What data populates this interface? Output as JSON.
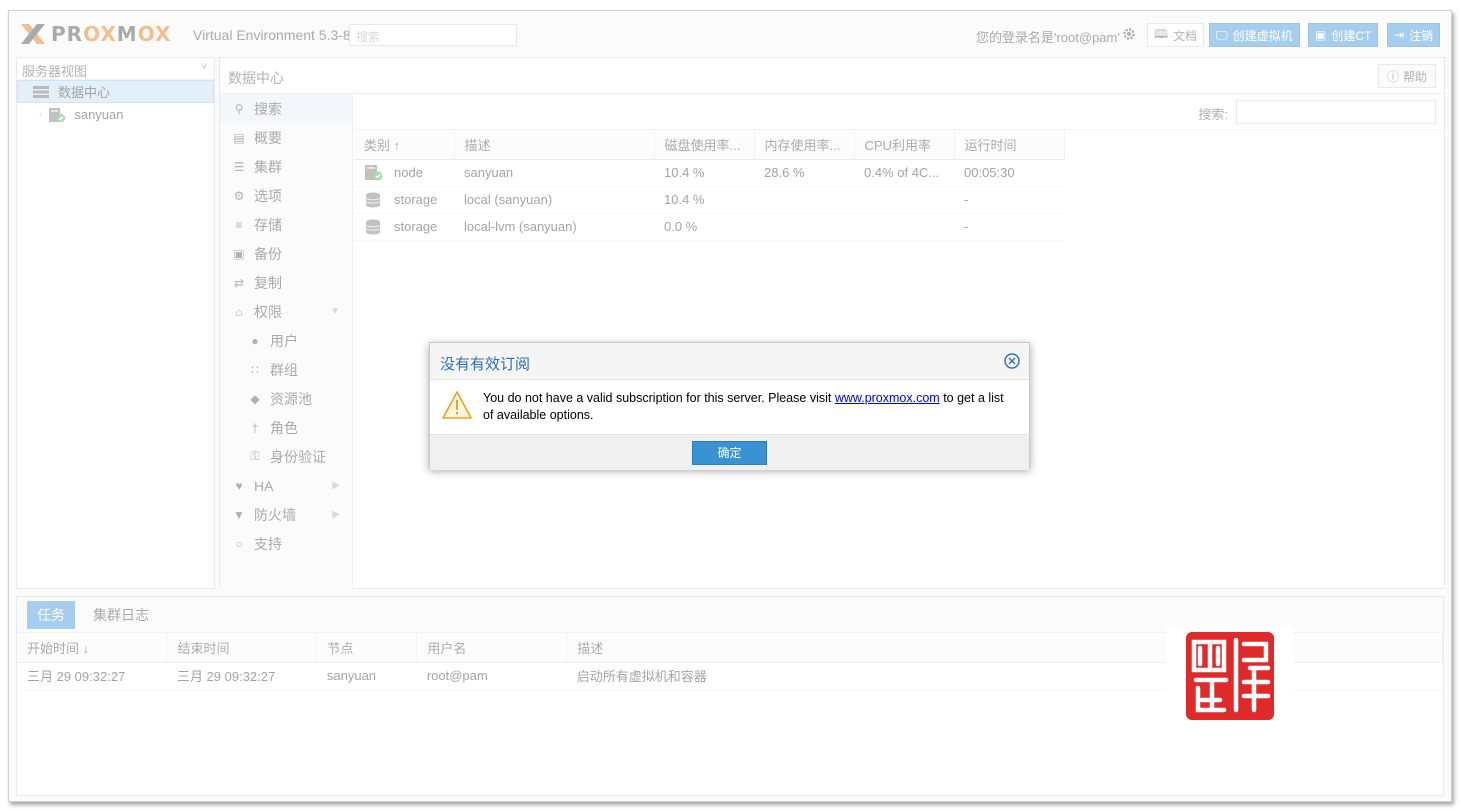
{
  "header": {
    "brand": "PROXMOX",
    "version": "Virtual Environment 5.3-8",
    "search_placeholder": "搜索",
    "login_text": "您的登录名是'root@pam'",
    "docs_label": "文档",
    "create_vm_label": "创建虚拟机",
    "create_ct_label": "创建CT",
    "logout_label": "注销"
  },
  "tree": {
    "view_select": "服务器视图",
    "items": [
      {
        "label": "数据中心"
      },
      {
        "label": "sanyuan"
      }
    ]
  },
  "main": {
    "title": "数据中心",
    "help_label": "帮助",
    "search_label": "搜索:"
  },
  "nav": {
    "items": [
      {
        "label": "搜索",
        "icon": "search-icon"
      },
      {
        "label": "概要",
        "icon": "book-icon"
      },
      {
        "label": "集群",
        "icon": "server-icon"
      },
      {
        "label": "选项",
        "icon": "gear-icon"
      },
      {
        "label": "存储",
        "icon": "database-icon"
      },
      {
        "label": "备份",
        "icon": "floppy-icon"
      },
      {
        "label": "复制",
        "icon": "retweet-icon"
      },
      {
        "label": "权限",
        "icon": "unlock-icon"
      },
      {
        "label": "用户",
        "icon": "user-icon"
      },
      {
        "label": "群组",
        "icon": "users-icon"
      },
      {
        "label": "资源池",
        "icon": "tags-icon"
      },
      {
        "label": "角色",
        "icon": "male-icon"
      },
      {
        "label": "身份验证",
        "icon": "key-icon"
      },
      {
        "label": "HA",
        "icon": "heartbeat-icon"
      },
      {
        "label": "防火墙",
        "icon": "shield-icon"
      },
      {
        "label": "支持",
        "icon": "comments-icon"
      }
    ]
  },
  "resource_table": {
    "headers": [
      "类别 ↑",
      "描述",
      "磁盘使用率...",
      "内存使用率...",
      "CPU利用率",
      "运行时间"
    ],
    "rows": [
      {
        "type": "node",
        "desc": "sanyuan",
        "disk": "10.4 %",
        "mem": "28.6 %",
        "cpu": "0.4% of 4C...",
        "uptime": "00:05:30"
      },
      {
        "type": "storage",
        "desc": "local (sanyuan)",
        "disk": "10.4 %",
        "mem": "",
        "cpu": "",
        "uptime": "-"
      },
      {
        "type": "storage",
        "desc": "local-lvm (sanyuan)",
        "disk": "0.0 %",
        "mem": "",
        "cpu": "",
        "uptime": "-"
      }
    ]
  },
  "bottom": {
    "tab_tasks": "任务",
    "tab_cluster_log": "集群日志",
    "headers": [
      "开始时间 ↓",
      "结束时间",
      "节点",
      "用户名",
      "描述"
    ],
    "rows": [
      {
        "start": "三月 29 09:32:27",
        "end": "三月 29 09:32:27",
        "node": "sanyuan",
        "user": "root@pam",
        "desc": "启动所有虚拟机和容器"
      }
    ]
  },
  "dialog": {
    "title": "没有有效订阅",
    "message_before": "You do not have a valid subscription for this server. Please visit ",
    "link_text": "www.proxmox.com",
    "message_after": " to get a list of available options.",
    "ok_label": "确定"
  },
  "colors": {
    "accent": "#3892d4",
    "brand_orange": "#e57000",
    "dialog_title": "#2a6ebb"
  }
}
